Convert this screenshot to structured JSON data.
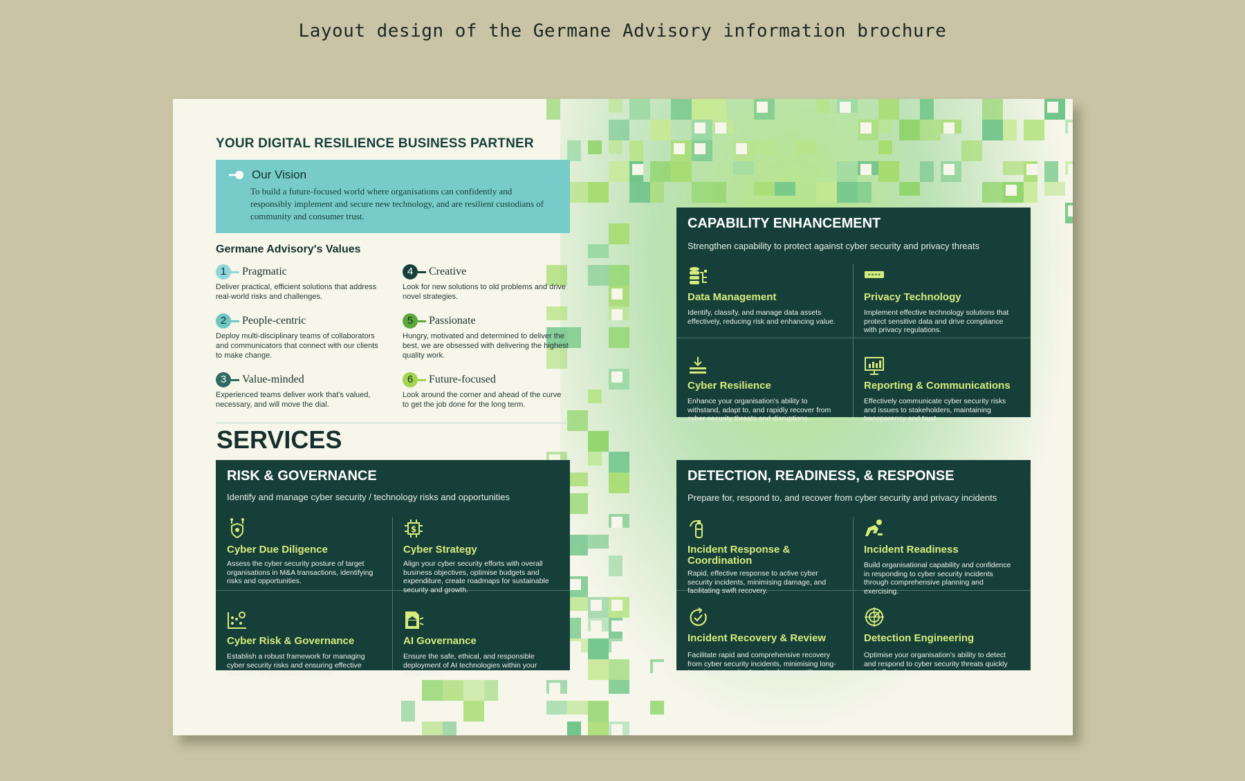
{
  "caption": "Layout design of the Germane Advisory information brochure",
  "colors": {
    "page_background": "#c9c4a6",
    "paper": "#f6f6ea",
    "dark_green": "#173f3a",
    "teal": "#77ccca",
    "lime_text": "#d6ec7c",
    "green_pixels": "#8fd46a"
  },
  "left": {
    "heading": "YOUR DIGITAL RESILIENCE BUSINESS PARTNER",
    "vision": {
      "title": "Our Vision",
      "icon": "key-icon",
      "text": "To build a future-focused world where organisations can confidently and responsibly implement and secure new technology, and are resilient custodians of community and consumer trust."
    },
    "values_heading": "Germane Advisory's Values",
    "values": [
      {
        "number": "1",
        "title": "Pragmatic",
        "text": "Deliver practical, efficient solutions that address real-world risks and challenges.",
        "color": "#8fd6d8"
      },
      {
        "number": "2",
        "title": "People-centric",
        "text": "Deploy multi-disciplinary teams of collaborators and communicators that connect with our clients to make change.",
        "color": "#6fc6c3"
      },
      {
        "number": "3",
        "title": "Value-minded",
        "text": "Experienced teams deliver work that's valued, necessary, and will move the dial.",
        "color": "#2f6a63"
      },
      {
        "number": "4",
        "title": "Creative",
        "text": "Look for new solutions to old problems and drive novel strategies.",
        "color": "#173f3a"
      },
      {
        "number": "5",
        "title": "Passionate",
        "text": "Hungry, motivated and determined to deliver the best, we are obsessed with delivering the highest quality work.",
        "color": "#5ca83a"
      },
      {
        "number": "6",
        "title": "Future-focused",
        "text": "Look around the corner and ahead of the curve to get the job done for the long term.",
        "color": "#a4d44c"
      }
    ],
    "services_title": "SERVICES"
  },
  "panels": {
    "risk": {
      "title": "RISK & GOVERNANCE",
      "subtitle": "Identify and manage cyber security / technology risks and opportunities",
      "items": [
        {
          "icon": "shield-network-icon",
          "title": "Cyber Due Diligence",
          "text": "Assess the cyber security posture of target organisations in M&A transactions, identifying risks and opportunities."
        },
        {
          "icon": "dollar-chip-icon",
          "title": "Cyber Strategy",
          "text": "Align your cyber security efforts with overall business objectives, optimise budgets and expenditure, create roadmaps for sustainable security and growth."
        },
        {
          "icon": "dashboard-chart-icon",
          "title": "Cyber Risk & Governance",
          "text": "Establish a robust framework for managing cyber security risks and ensuring effective oversight of cyber security efforts."
        },
        {
          "icon": "document-institution-icon",
          "title": "AI Governance",
          "text": "Ensure the safe, ethical, and responsible deployment of AI technologies within your organisation."
        }
      ]
    },
    "capability": {
      "title": "CAPABILITY ENHANCEMENT",
      "subtitle": "Strengthen capability to protect against cyber security and privacy threats",
      "items": [
        {
          "icon": "database-icon",
          "title": "Data Management",
          "text": "Identify, classify, and manage data assets effectively, reducing risk and enhancing value."
        },
        {
          "icon": "password-icon",
          "title": "Privacy Technology",
          "text": "Implement effective technology solutions that protect sensitive data and drive compliance with privacy regulations."
        },
        {
          "icon": "layers-download-icon",
          "title": "Cyber Resilience",
          "text": "Enhance your organisation's ability to withstand, adapt to, and rapidly recover from cyber security threats and disruptions."
        },
        {
          "icon": "presentation-chart-icon",
          "title": "Reporting & Communications",
          "text": "Effectively communicate cyber security risks and issues to stakeholders, maintaining transparency and trust."
        }
      ]
    },
    "detection": {
      "title": "DETECTION, READINESS, & RESPONSE",
      "subtitle": "Prepare for, respond to, and recover from cyber security and privacy incidents",
      "items": [
        {
          "icon": "fire-extinguisher-icon",
          "title": "Incident Response & Coordination",
          "text": "Rapid, effective response to active cyber security incidents, minimising damage, and facilitating swift recovery."
        },
        {
          "icon": "runner-ready-icon",
          "title": "Incident Readiness",
          "text": "Build organisational capability and confidence in responding to cyber security incidents through comprehensive planning and exercising."
        },
        {
          "icon": "recovery-check-icon",
          "title": "Incident Recovery & Review",
          "text": "Facilitate rapid and comprehensive recovery from cyber security incidents, minimising long-term impact and enhancing future resilience."
        },
        {
          "icon": "radar-target-icon",
          "title": "Detection Engineering",
          "text": "Optimise your organisation's ability to detect and respond to cyber security threats quickly and effectively."
        }
      ]
    }
  }
}
